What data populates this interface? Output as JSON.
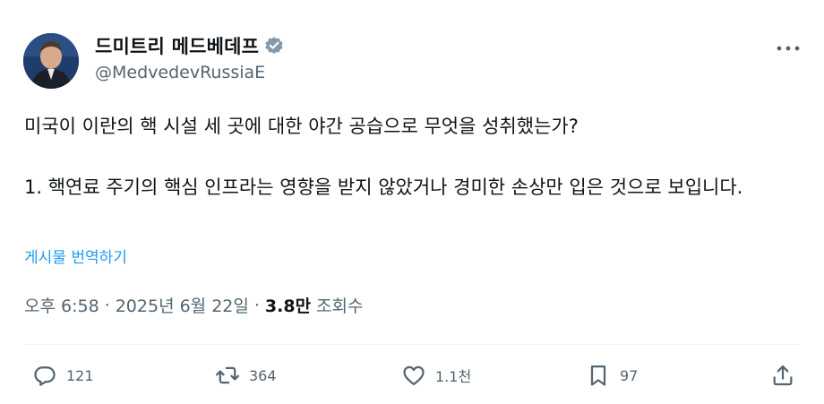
{
  "author": {
    "display_name": "드미트리 메드베데프",
    "handle": "@MedvedevRussiaE",
    "verified_color": "#829aab"
  },
  "tweet": {
    "paragraph1": "미국이 이란의 핵 시설 세 곳에 대한 야간 공습으로 무엇을 성취했는가?",
    "paragraph2": "1. 핵연료 주기의 핵심 인프라는 영향을 받지 않았거나 경미한 손상만 입은 것으로 보입니다.",
    "translate_link": "게시물 번역하기"
  },
  "meta": {
    "time": "오후 6:58",
    "separator": "·",
    "date": "2025년 6월 22일",
    "views_count": "3.8만",
    "views_label": "조회수"
  },
  "actions": {
    "replies": "121",
    "reposts": "364",
    "likes": "1.1천",
    "bookmarks": "97"
  },
  "icons": [
    "verified-badge-icon",
    "more-icon",
    "reply-icon",
    "repost-icon",
    "like-icon",
    "bookmark-icon",
    "share-icon"
  ],
  "colors": {
    "link": "#1d9bf0",
    "secondary_text": "#536471",
    "primary_text": "#0f1419"
  }
}
